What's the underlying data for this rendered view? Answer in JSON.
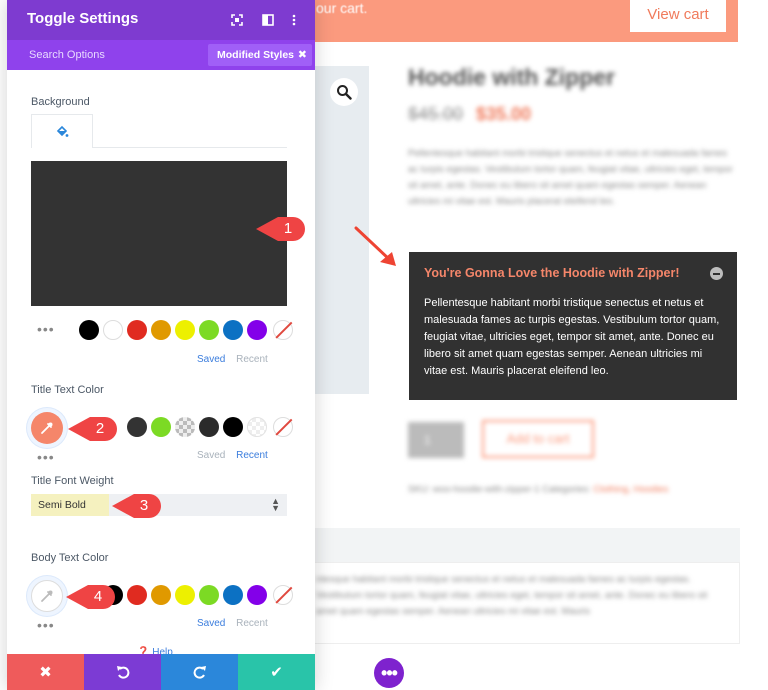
{
  "panel": {
    "title": "Toggle Settings",
    "search_options": "Search Options",
    "modified_styles": "Modified Styles",
    "background_label": "Background",
    "title_text_color_label": "Title Text Color",
    "title_font_weight_label": "Title Font Weight",
    "title_font_weight_value": "Semi Bold",
    "body_text_color_label": "Body Text Color",
    "saved_label": "Saved",
    "recent_label": "Recent",
    "help_label": "Help",
    "background_color": "#333333",
    "title_text_color": "#f5866a"
  },
  "swatch_colors": {
    "background": [
      "#000000",
      "#ffffff",
      "#e02b20",
      "#e09900",
      "#edf000",
      "#7cda24",
      "#0c71c3",
      "#8300e9"
    ],
    "title_recent": [
      "#333333",
      "#7cda24",
      "checker",
      "#2b2b2b",
      "#000000",
      "clear"
    ],
    "body": [
      "#000000",
      "#e02b20",
      "#e09900",
      "#edf000",
      "#7cda24",
      "#0c71c3",
      "#8300e9"
    ]
  },
  "callouts": [
    "1",
    "2",
    "3",
    "4"
  ],
  "store": {
    "cart_message": "our cart.",
    "view_cart": "View cart",
    "product_title": "Hoodie with Zipper",
    "old_price": "$45.00",
    "new_price": "$35.00",
    "description": "Pellentesque habitant morbi tristique senectus et netus et malesuada fames ac turpis egestas. Vestibulum tortor quam, feugiat vitae, ultricies eget, tempor sit amet, ante. Donec eu libero sit amet quam egestas semper. Aenean ultricies mi vitae est. Mauris placerat eleifend leo.",
    "quantity": "1",
    "add_to_cart": "Add to cart",
    "sku_line": "SKU: woo-hoodie-with-zipper-1 Categories: ",
    "categories": "Clothing, Hoodies",
    "tab_text": "ntesque habitant morbi tristique senectus et netus et malesuada fames ac turpis egestas. Vestibulum tortor quam, feugiat vitae, ultricies eget, tempor sit amet, ante. Donec eu libero sit amet quam egestas semper. Aenean ultricies mi vitae est. Mauris"
  },
  "toggle": {
    "title": "You're Gonna Love the Hoodie with Zipper!",
    "body": "Pellentesque habitant morbi tristique senectus et netus et malesuada fames ac turpis egestas. Vestibulum tortor quam, feugiat vitae, ultricies eget, tempor sit amet, ante. Donec eu libero sit amet quam egestas semper. Aenean ultricies mi vitae est. Mauris placerat eleifend leo."
  },
  "icons": {
    "zoom": "search-icon",
    "panel_expand": "expand-icon",
    "panel_columns": "columns-icon",
    "panel_menu": "more-vertical-icon",
    "footer": [
      "close-icon",
      "undo-icon",
      "redo-icon",
      "check-icon"
    ]
  },
  "colors": {
    "panel_header": "#7e3bd0",
    "panel_subheader": "#8f42ec",
    "footer_close": "#ef5b5b",
    "footer_undo": "#7c3bd4",
    "footer_redo": "#2b87da",
    "footer_save": "#29c4a9",
    "callout_red": "#ef4444",
    "cart_bar": "#fb9a7e"
  }
}
